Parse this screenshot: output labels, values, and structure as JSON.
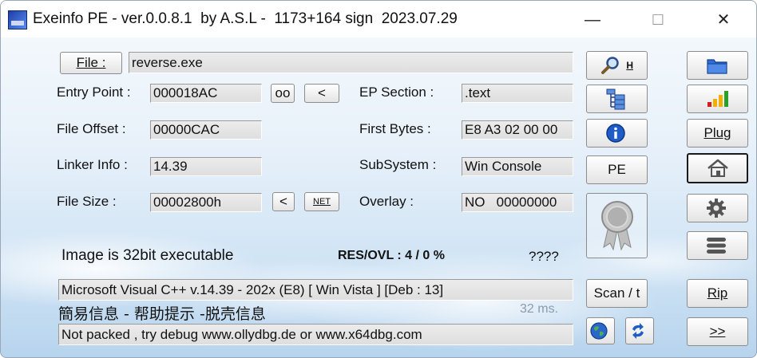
{
  "window": {
    "title": "Exeinfo PE - ver.0.0.8.1  by A.S.L -  1173+164 sign  2023.07.29",
    "minimize": "—",
    "maximize": "☐",
    "close": "✕"
  },
  "file": {
    "button_label": "File :",
    "path": "reverse.exe"
  },
  "entry_point": {
    "label": "Entry Point :",
    "value": "000018AC",
    "oo_button": "oo",
    "lt_button": "<"
  },
  "file_offset": {
    "label": "File Offset :",
    "value": "00000CAC"
  },
  "linker_info": {
    "label": "Linker Info :",
    "value": "14.39"
  },
  "file_size": {
    "label": "File Size :",
    "value": "00002800h",
    "lt_button": "<",
    "net_button": "NET"
  },
  "ep_section": {
    "label": "EP Section :",
    "value": ".text"
  },
  "first_bytes": {
    "label": "First Bytes :",
    "value": "E8 A3 02 00 00"
  },
  "subsystem": {
    "label": "SubSystem :",
    "value": "Win Console"
  },
  "overlay": {
    "label": "Overlay :",
    "value": "NO   00000000"
  },
  "status": {
    "image_info": "Image is 32bit executable",
    "res_ovl": "RES/OVL : 4 / 0 %",
    "unknown": "????",
    "detection": "Microsoft Visual C++ v.14.39 - 202x (E8) [ Win Vista ] [Deb : 13]",
    "help_links": "簡易信息 - 帮助提示 -脱壳信息",
    "time": "32 ms.",
    "hint": "Not packed , try debug www.ollydbg.de or www.x64dbg.com"
  },
  "tools": {
    "search_h": "H",
    "pe_button": "PE",
    "scan_button": "Scan / t",
    "plug_button": "Plug",
    "rip_button": "Rip",
    "next_button": ">>"
  },
  "colors": {
    "accent": "#1e5cc8",
    "folder": "#2f6fd6",
    "bars": [
      "#d11f1f",
      "#f0b000",
      "#2aa02a"
    ]
  }
}
